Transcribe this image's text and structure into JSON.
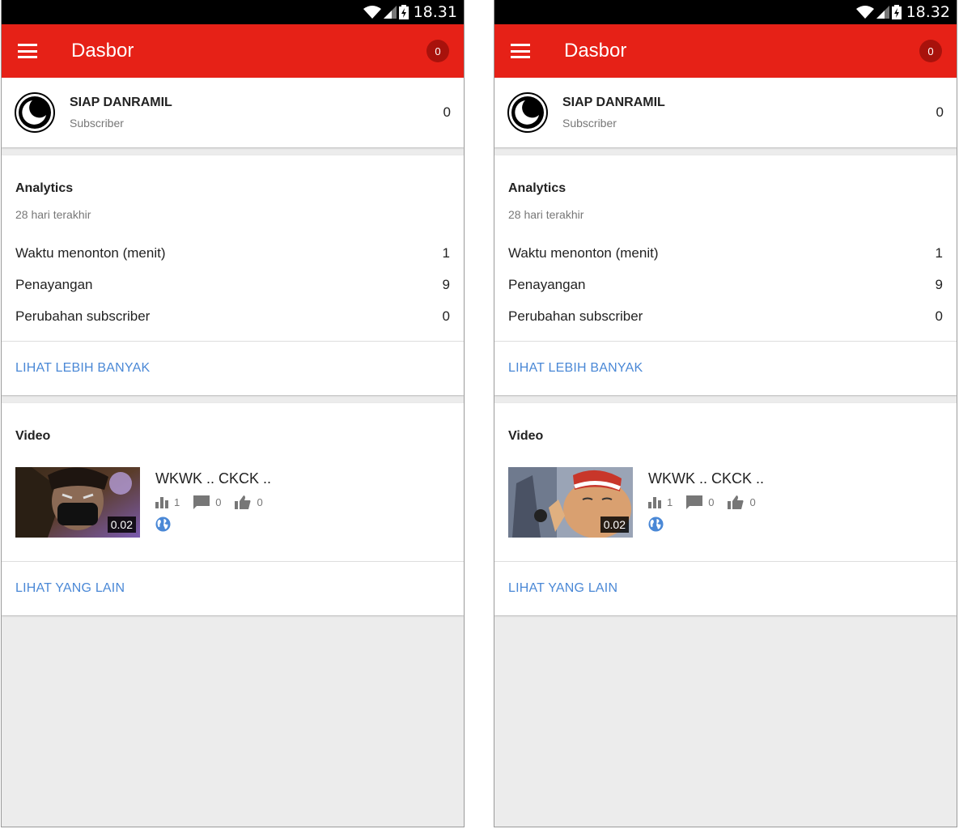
{
  "colors": {
    "appbar": "#e62117",
    "badge": "#a8120c",
    "link": "#4a88d6",
    "background": "#ececec"
  },
  "screens": [
    {
      "status": {
        "time": "18.31"
      },
      "appbar": {
        "title": "Dasbor",
        "notifications": "0"
      },
      "channel": {
        "name": "SIAP DANRAMIL",
        "subtitle": "Subscriber",
        "count": "0"
      },
      "analytics": {
        "title": "Analytics",
        "period": "28 hari terakhir",
        "metrics": [
          {
            "label": "Waktu menonton (menit)",
            "value": "1"
          },
          {
            "label": "Penayangan",
            "value": "9"
          },
          {
            "label": "Perubahan subscriber",
            "value": "0"
          }
        ],
        "more_link": "LIHAT LEBIH BANYAK"
      },
      "video": {
        "title": "Video",
        "item": {
          "title": "WKWK .. CKCK ..",
          "duration": "0.02",
          "views": "1",
          "comments": "0",
          "likes": "0",
          "visibility_icon": "globe-icon"
        },
        "more_link": "LIHAT YANG LAIN"
      }
    },
    {
      "status": {
        "time": "18.32"
      },
      "appbar": {
        "title": "Dasbor",
        "notifications": "0"
      },
      "channel": {
        "name": "SIAP DANRAMIL",
        "subtitle": "Subscriber",
        "count": "0"
      },
      "analytics": {
        "title": "Analytics",
        "period": "28 hari terakhir",
        "metrics": [
          {
            "label": "Waktu menonton (menit)",
            "value": "1"
          },
          {
            "label": "Penayangan",
            "value": "9"
          },
          {
            "label": "Perubahan subscriber",
            "value": "0"
          }
        ],
        "more_link": "LIHAT LEBIH BANYAK"
      },
      "video": {
        "title": "Video",
        "item": {
          "title": "WKWK .. CKCK ..",
          "duration": "0.02",
          "views": "1",
          "comments": "0",
          "likes": "0",
          "visibility_icon": "globe-icon"
        },
        "more_link": "LIHAT YANG LAIN"
      }
    }
  ]
}
